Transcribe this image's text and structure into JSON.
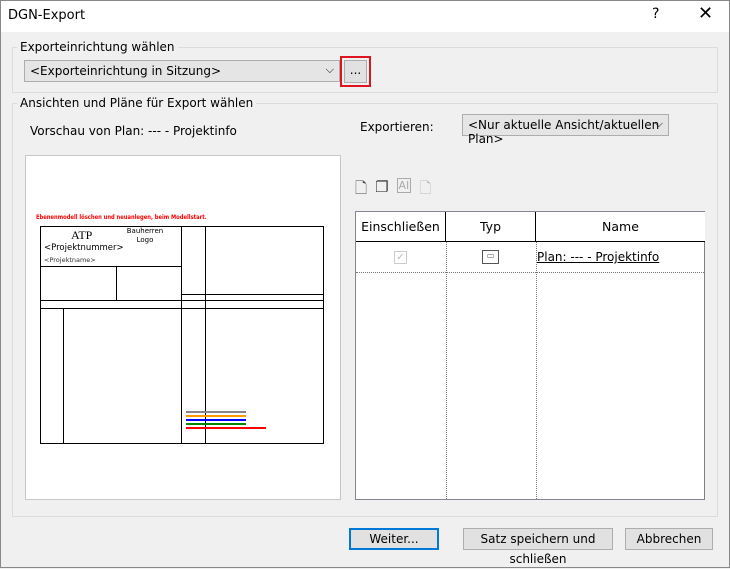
{
  "window": {
    "title": "DGN-Export",
    "help_label": "?",
    "close_label": "✕"
  },
  "setup_group": {
    "label": "Exporteinrichtung wählen",
    "combo_value": "<Exporteinrichtung in Sitzung>",
    "browse_label": "..."
  },
  "views_group": {
    "label": "Ansichten und Pläne für Export wählen",
    "preview_label": "Vorschau von Plan: --- - Projektinfo",
    "export_label": "Exportieren:",
    "export_value": "<Nur aktuelle Ansicht/aktuellen Plan>"
  },
  "preview": {
    "warning": "Ebenenmodell löschen und neuanlegen, beim Modellstart.",
    "logo": "ATP",
    "client_logo": "Bauherren Logo",
    "project_number": "<Projektnummer>",
    "project_name": "<Projektname>",
    "colors": {
      "warning": "#ff0000"
    }
  },
  "toolbar": {
    "icons": [
      "new-set-icon",
      "duplicate-set-icon",
      "rename-set-icon",
      "delete-set-icon"
    ]
  },
  "table": {
    "headers": [
      "Einschließen",
      "Typ",
      "Name"
    ],
    "rows": [
      {
        "included": true,
        "type_icon": "sheet-icon",
        "name": "Plan: --- - Projektinfo"
      }
    ]
  },
  "buttons": {
    "next": "Weiter...",
    "save_close": "Satz speichern und schließen",
    "cancel": "Abbrechen"
  }
}
